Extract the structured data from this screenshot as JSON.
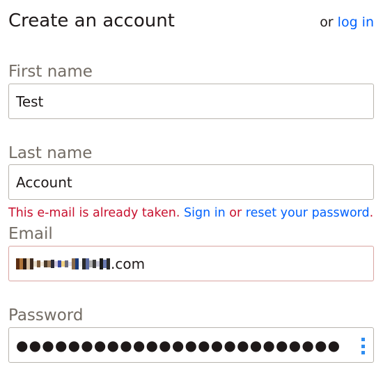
{
  "header": {
    "title": "Create an account",
    "or_text": "or",
    "login_link": "log in"
  },
  "first_name": {
    "label": "First name",
    "value": "Test"
  },
  "last_name": {
    "label": "Last name",
    "value": "Account"
  },
  "error": {
    "text": "This e-mail is already taken.",
    "sign_in_link": "Sign in",
    "or_text": "or",
    "reset_link": "reset your password",
    "period": "."
  },
  "email": {
    "label": "Email",
    "visible_suffix": ".com"
  },
  "password": {
    "label": "Password",
    "masked_value": "●●●●●●●●●●●●●●●●●●●●●●●●●",
    "manager_icon": "password-manager-icon"
  },
  "colors": {
    "link": "#0061fe",
    "error": "#c8102e",
    "label": "#736c64",
    "text": "#1e1919",
    "pw_icon": "#2f8df0"
  }
}
